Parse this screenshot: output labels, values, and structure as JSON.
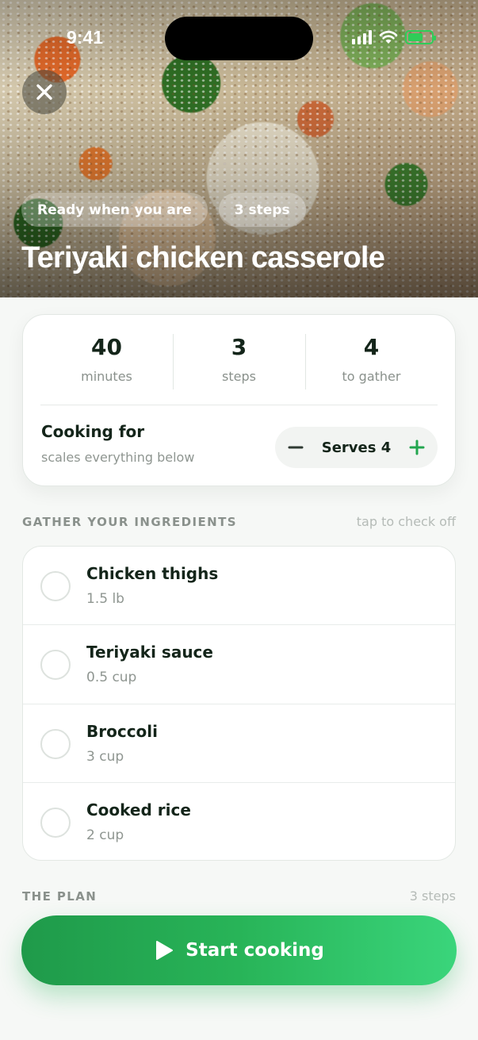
{
  "status": {
    "time": "9:41"
  },
  "hero": {
    "pills": [
      "Ready when you are",
      "3 steps"
    ],
    "title": "Teriyaki chicken casserole"
  },
  "stats": [
    {
      "value": "40",
      "label": "minutes"
    },
    {
      "value": "3",
      "label": "steps"
    },
    {
      "value": "4",
      "label": "to gather"
    }
  ],
  "cooking_for": {
    "title": "Cooking for",
    "subtitle": "scales everything below",
    "serves_label": "Serves 4"
  },
  "ingredients_section": {
    "title": "GATHER YOUR INGREDIENTS",
    "note": "tap to check off"
  },
  "ingredients": [
    {
      "name": "Chicken thighs",
      "qty": "1.5 lb"
    },
    {
      "name": "Teriyaki sauce",
      "qty": "0.5 cup"
    },
    {
      "name": "Broccoli",
      "qty": "3 cup"
    },
    {
      "name": "Cooked rice",
      "qty": "2 cup"
    }
  ],
  "plan_section": {
    "title": "THE PLAN",
    "note": "3 steps"
  },
  "cta": {
    "label": "Start cooking"
  },
  "colors": {
    "accent": "#28b458",
    "text": "#14251a",
    "muted": "#8a918c"
  },
  "icons": [
    "close-icon",
    "minus-icon",
    "plus-icon",
    "play-icon",
    "signal-icon",
    "wifi-icon",
    "battery-icon"
  ]
}
